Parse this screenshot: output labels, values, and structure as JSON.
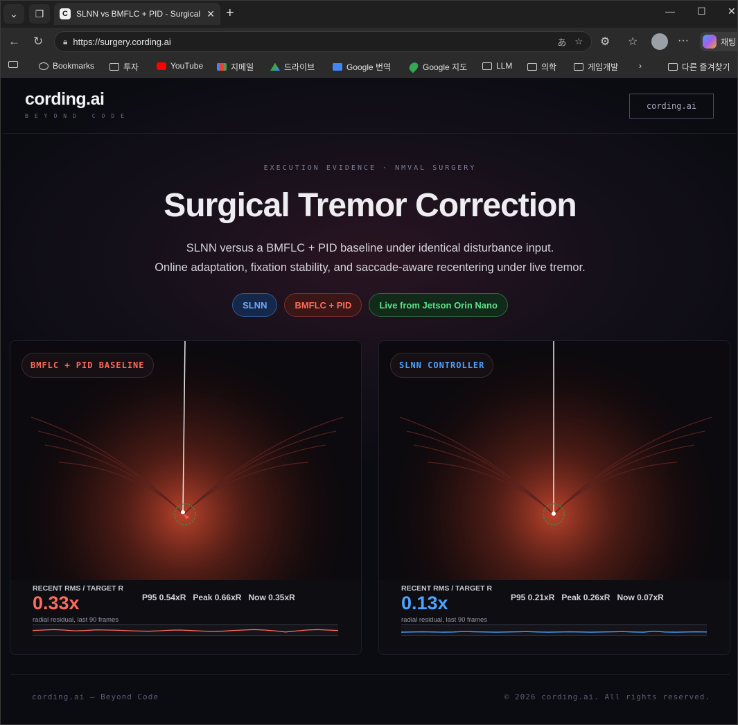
{
  "browser": {
    "tab_title": "SLNN vs BMFLC + PID - Surgical Tr",
    "tab_favicon": "C",
    "url": "https://surgery.cording.ai",
    "copilot_label": "채팅",
    "bookmarks": [
      "Bookmarks",
      "투자",
      "YouTube",
      "지메일",
      "드라이브",
      "Google 번역",
      "Google 지도",
      "LLM",
      "의학",
      "게임개발",
      "다른 즐겨찾기"
    ]
  },
  "header": {
    "logo": "cording.ai",
    "logo_sub": "BEYOND CODE",
    "button": "cording.ai"
  },
  "hero": {
    "eyebrow": "EXECUTION EVIDENCE · NMVAL SURGERY",
    "title": "Surgical Tremor Correction",
    "subtitle_1": "SLNN versus a BMFLC + PID baseline under identical disturbance input.",
    "subtitle_2": "Online adaptation, fixation stability, and saccade-aware recentering under live tremor.",
    "pills": [
      "SLNN",
      "BMFLC + PID",
      "Live from Jetson Orin Nano"
    ]
  },
  "panels": [
    {
      "badge": "BMFLC + PID BASELINE",
      "accent": "#ff6b5b",
      "stat_label": "RECENT RMS / TARGET R",
      "rms": "0.33x",
      "caption": "radial residual, last 90 frames",
      "p95": "P95 0.54xR",
      "peak": "Peak 0.66xR",
      "now": "Now 0.35xR",
      "sparkline": [
        0.55,
        0.5,
        0.45,
        0.5,
        0.58,
        0.55,
        0.48,
        0.5,
        0.52,
        0.56,
        0.6,
        0.62,
        0.58,
        0.52,
        0.5,
        0.55,
        0.6,
        0.65,
        0.62,
        0.55,
        0.5,
        0.45,
        0.5,
        0.58,
        0.7,
        0.6,
        0.5,
        0.45,
        0.5,
        0.55
      ]
    },
    {
      "badge": "SLNN CONTROLLER",
      "accent": "#4da3ff",
      "stat_label": "RECENT RMS / TARGET R",
      "rms": "0.13x",
      "caption": "radial residual, last 90 frames",
      "p95": "P95 0.21xR",
      "peak": "Peak 0.26xR",
      "now": "Now 0.07xR",
      "sparkline": [
        0.72,
        0.7,
        0.68,
        0.7,
        0.72,
        0.7,
        0.65,
        0.68,
        0.7,
        0.72,
        0.7,
        0.68,
        0.66,
        0.7,
        0.72,
        0.7,
        0.68,
        0.7,
        0.72,
        0.7,
        0.68,
        0.66,
        0.7,
        0.72,
        0.62,
        0.7,
        0.72,
        0.7,
        0.68,
        0.7
      ]
    }
  ],
  "footer": {
    "left": "cording.ai — Beyond Code",
    "right": "© 2026 cording.ai. All rights reserved."
  }
}
